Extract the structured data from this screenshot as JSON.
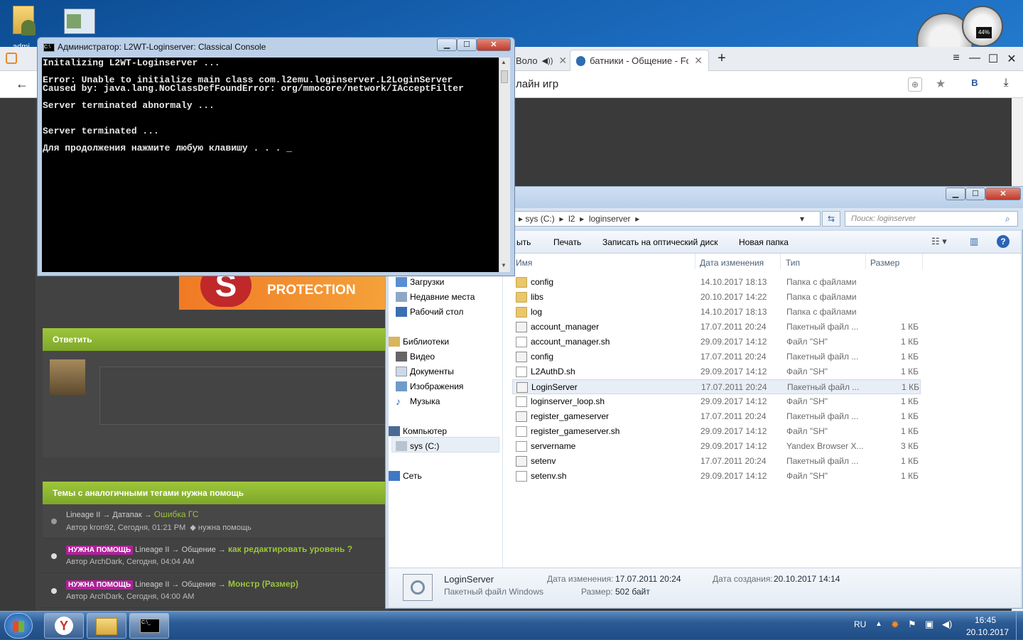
{
  "desktop": {
    "icons": [
      {
        "label": "admi"
      },
      {
        "label": ""
      }
    ]
  },
  "gadget": {
    "percent": "44%"
  },
  "browser": {
    "tabs": [
      {
        "label": "Воло",
        "active": false
      },
      {
        "label": "батники - Общение - For",
        "active": true
      }
    ],
    "new_tab": "+",
    "address_text": "лайн игр",
    "window_controls": {
      "menu": "≡",
      "minimize": "—",
      "maximize": "☐",
      "close": "✕"
    },
    "profile_letter": "B"
  },
  "forum": {
    "banner_text": "PROTECTION",
    "reply_header": "Ответить",
    "similar_header": "Темы с аналогичными тегами нужна помощь",
    "topics": [
      {
        "badge": "",
        "path": "Lineage II → Датапак →",
        "title": "Ошибка ГС",
        "meta": "Автор kron92, Сегодня, 01:21 PM",
        "tag": "нужна помощь"
      },
      {
        "badge": "НУЖНА ПОМОЩЬ",
        "path": "Lineage II → Общение →",
        "title": "как редактировать уровень ?",
        "meta": "Автор ArchDark, Сегодня, 04:04 AM",
        "tag": ""
      },
      {
        "badge": "НУЖНА ПОМОЩЬ",
        "path": "Lineage II → Общение →",
        "title": "Монстр (Размер)",
        "meta": "Автор ArchDark, Сегодня, 04:00 AM",
        "tag": ""
      }
    ]
  },
  "console": {
    "title": "Администратор:  L2WT-Loginserver: Classical Console",
    "lines": "Initalizing L2WT-Loginserver ...\n\nError: Unable to initialize main class com.l2emu.loginserver.L2LoginServer\nCaused by: java.lang.NoClassDefFoundError: org/mmocore/network/IAcceptFilter\n\nServer terminated abnormaly ...\n\n\nServer terminated ...\n\nДля продолжения нажмите любую клавишу . . . _"
  },
  "explorer": {
    "breadcrumb": [
      "sys (C:)",
      "l2",
      "loginserver"
    ],
    "search_placeholder": "Поиск: loginserver",
    "toolbar": {
      "partial": "ыть",
      "print": "Печать",
      "burn": "Записать на оптический диск",
      "new_folder": "Новая папка"
    },
    "columns": {
      "name": "Имя",
      "date": "Дата изменения",
      "type": "Тип",
      "size": "Размер"
    },
    "nav": {
      "downloads": "Загрузки",
      "recent": "Недавние места",
      "desktop": "Рабочий стол",
      "libraries": "Библиотеки",
      "video": "Видео",
      "documents": "Документы",
      "images": "Изображения",
      "music": "Музыка",
      "computer": "Компьютер",
      "drive": "sys (C:)",
      "network": "Сеть"
    },
    "files": [
      {
        "name": "config",
        "date": "14.10.2017 18:13",
        "type": "Папка с файлами",
        "size": "",
        "kind": "folder"
      },
      {
        "name": "libs",
        "date": "20.10.2017 14:22",
        "type": "Папка с файлами",
        "size": "",
        "kind": "folder"
      },
      {
        "name": "log",
        "date": "14.10.2017 18:13",
        "type": "Папка с файлами",
        "size": "",
        "kind": "folder"
      },
      {
        "name": "account_manager",
        "date": "17.07.2011 20:24",
        "type": "Пакетный файл ...",
        "size": "1 КБ",
        "kind": "bat"
      },
      {
        "name": "account_manager.sh",
        "date": "29.09.2017 14:12",
        "type": "Файл \"SH\"",
        "size": "1 КБ",
        "kind": "doc"
      },
      {
        "name": "config",
        "date": "17.07.2011 20:24",
        "type": "Пакетный файл ...",
        "size": "1 КБ",
        "kind": "bat"
      },
      {
        "name": "L2AuthD.sh",
        "date": "29.09.2017 14:12",
        "type": "Файл \"SH\"",
        "size": "1 КБ",
        "kind": "doc"
      },
      {
        "name": "LoginServer",
        "date": "17.07.2011 20:24",
        "type": "Пакетный файл ...",
        "size": "1 КБ",
        "kind": "bat",
        "selected": true
      },
      {
        "name": "loginserver_loop.sh",
        "date": "29.09.2017 14:12",
        "type": "Файл \"SH\"",
        "size": "1 КБ",
        "kind": "doc"
      },
      {
        "name": "register_gameserver",
        "date": "17.07.2011 20:24",
        "type": "Пакетный файл ...",
        "size": "1 КБ",
        "kind": "bat"
      },
      {
        "name": "register_gameserver.sh",
        "date": "29.09.2017 14:12",
        "type": "Файл \"SH\"",
        "size": "1 КБ",
        "kind": "doc"
      },
      {
        "name": "servername",
        "date": "29.09.2017 14:12",
        "type": "Yandex Browser X...",
        "size": "3 КБ",
        "kind": "doc"
      },
      {
        "name": "setenv",
        "date": "17.07.2011 20:24",
        "type": "Пакетный файл ...",
        "size": "1 КБ",
        "kind": "bat"
      },
      {
        "name": "setenv.sh",
        "date": "29.09.2017 14:12",
        "type": "Файл \"SH\"",
        "size": "1 КБ",
        "kind": "doc"
      }
    ],
    "details": {
      "name": "LoginServer",
      "type": "Пакетный файл Windows",
      "modified_label": "Дата изменения:",
      "modified": "17.07.2011 20:24",
      "created_label": "Дата создания:",
      "created": "20.10.2017 14:14",
      "size_label": "Размер:",
      "size": "502 байт"
    }
  },
  "taskbar": {
    "lang": "RU",
    "time": "16:45",
    "date": "20.10.2017",
    "console_label": "C:\\_"
  }
}
